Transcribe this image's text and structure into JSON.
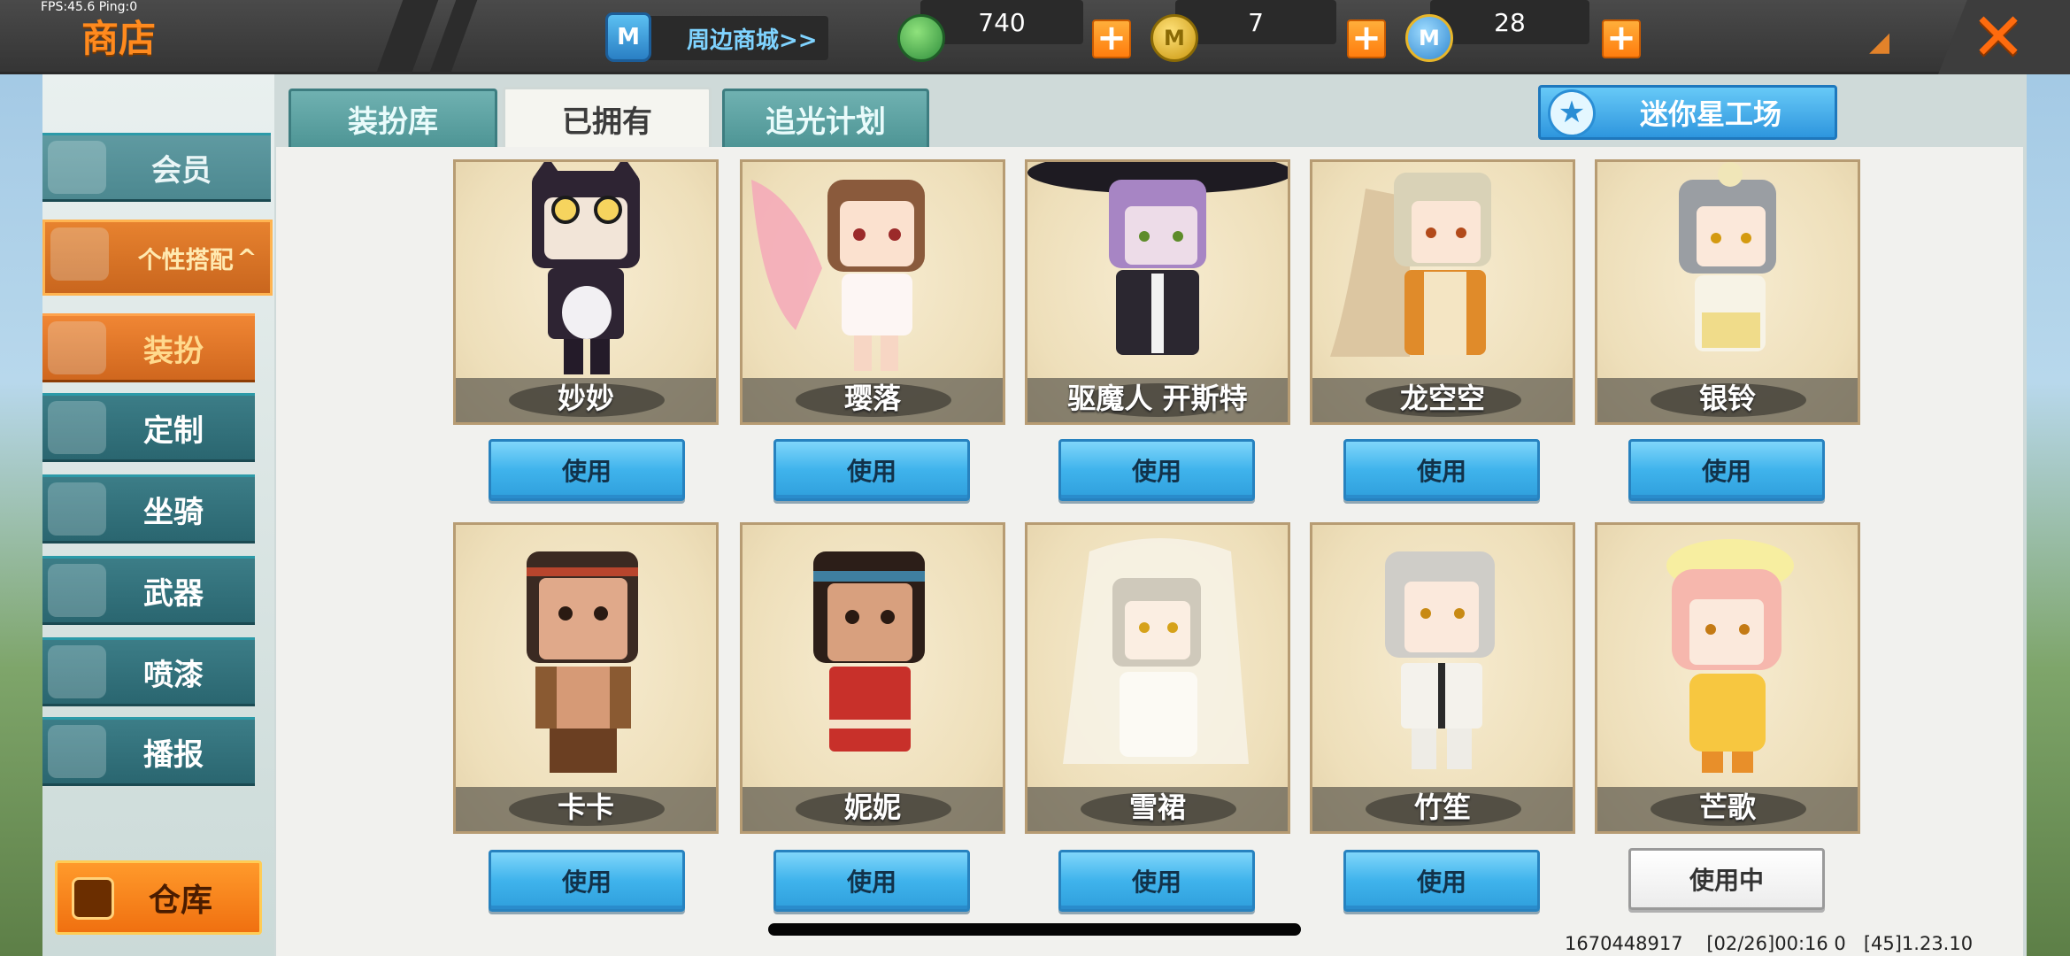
{
  "status": {
    "fps_ping": "FPS:45.6  Ping:0"
  },
  "header": {
    "title": "商店",
    "mall_link": "周边商城>>",
    "currencies": [
      {
        "name": "mini-beans",
        "value": "740",
        "color": "#3aa54a"
      },
      {
        "name": "mini-coins",
        "value": "7",
        "color": "#e3b417"
      },
      {
        "name": "star-coins",
        "value": "28",
        "color": "#3f9de0"
      }
    ]
  },
  "sidebar": {
    "member": "会员",
    "group": "个性搭配",
    "items": [
      "装扮",
      "定制",
      "坐骑",
      "武器",
      "喷漆",
      "播报"
    ],
    "active_item": "装扮",
    "warehouse": "仓库"
  },
  "tabs": [
    {
      "label": "装扮库",
      "active": false
    },
    {
      "label": "已拥有",
      "active": true
    },
    {
      "label": "追光计划",
      "active": false
    }
  ],
  "studio_button": "迷你星工场",
  "skins": [
    {
      "name": "妙妙",
      "action": "使用"
    },
    {
      "name": "璎落",
      "action": "使用"
    },
    {
      "name": "驱魔人 开斯特",
      "action": "使用"
    },
    {
      "name": "龙空空",
      "action": "使用"
    },
    {
      "name": "银铃",
      "action": "使用"
    },
    {
      "name": "卡卡",
      "action": "使用"
    },
    {
      "name": "妮妮",
      "action": "使用"
    },
    {
      "name": "雪裙",
      "action": "使用"
    },
    {
      "name": "竹笙",
      "action": "使用"
    },
    {
      "name": "芒歌",
      "action": "使用中"
    }
  ],
  "footer": {
    "uid": "1670448917",
    "timestamp": "[02/26]00:16 0",
    "version": "[45]1.23.10"
  },
  "colors": {
    "accent_orange": "#ff8a1e",
    "teal": "#3c7d87",
    "use_button_blue": "#3fb3ec"
  }
}
